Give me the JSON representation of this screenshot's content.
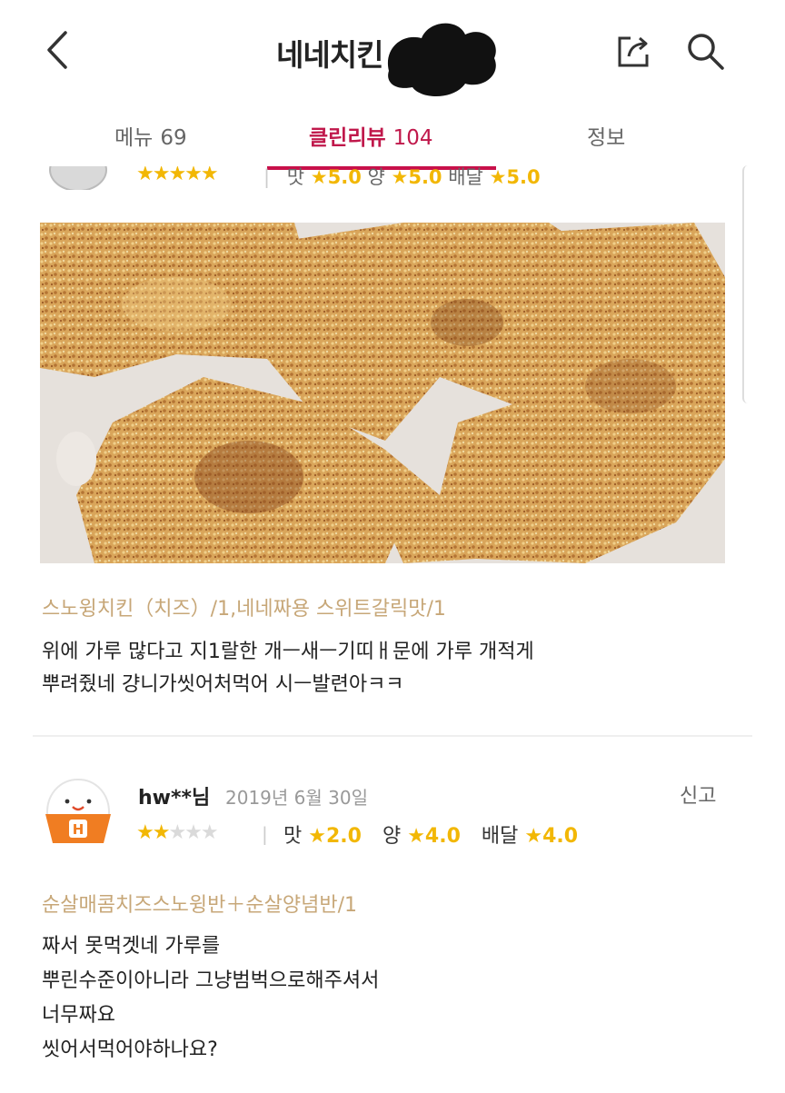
{
  "header": {
    "title": "네네치킨",
    "back_icon": "chevron-left-icon",
    "share_icon": "share-icon",
    "search_icon": "search-icon"
  },
  "tabs": [
    {
      "label": "메뉴",
      "count": "69",
      "active": false
    },
    {
      "label": "클린리뷰",
      "count": "104",
      "active": true
    },
    {
      "label": "정보",
      "count": "",
      "active": false
    }
  ],
  "colors": {
    "accent": "#c8104a",
    "star": "#f2b705",
    "menu_text": "#c7a778"
  },
  "review1": {
    "stars": "★★★★★",
    "score_labels": {
      "taste": "맛",
      "amount": "양",
      "delivery": "배달"
    },
    "scores": {
      "taste": "★5.0",
      "amount": "★5.0",
      "delivery": "★5.0"
    },
    "menu": "스노윙치킨（치즈）/1,네네짜용 스위트갈릭맛/1",
    "text_lines": [
      "위에 가루 많다고 지1랄한 개ㅡ새ㅡ기띠ㅐ문에 가루 개적게",
      "뿌려줬네 걍니가씻어처먹어 시ㅡ발련아ㅋㅋ"
    ]
  },
  "review2": {
    "user": "hw**님",
    "date": "2019년 6월 30일",
    "report_label": "신고",
    "rating": 2,
    "stars_on": "★★",
    "stars_off": "★★★",
    "score_labels": {
      "taste": "맛",
      "amount": "양",
      "delivery": "배달"
    },
    "scores": {
      "taste": "★2.0",
      "amount": "★4.0",
      "delivery": "★4.0"
    },
    "menu": "순살매콤치즈스노윙반＋순살양념반/1",
    "text_lines": [
      "짜서 못먹겟네 가루를",
      "뿌린수준이아니라 그냥범벅으로해주셔서",
      "너무짜요",
      "씻어서먹어야하나요?"
    ]
  }
}
